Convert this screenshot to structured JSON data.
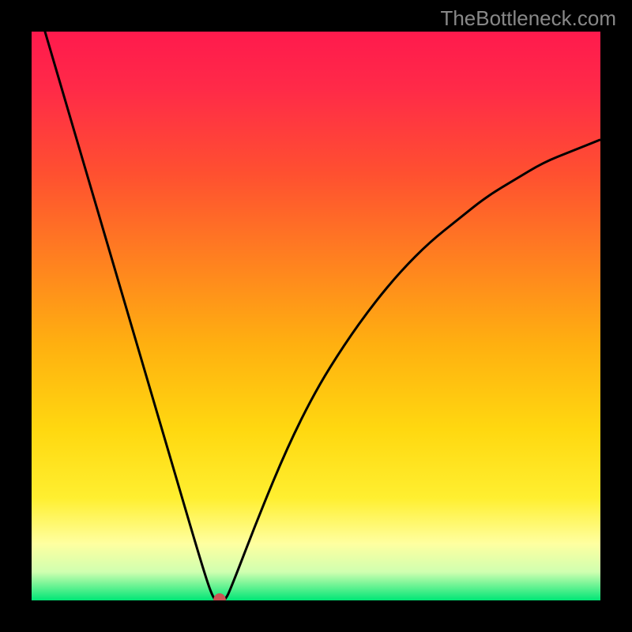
{
  "watermark": "TheBottleneck.com",
  "chart_data": {
    "type": "line",
    "title": "",
    "xlabel": "",
    "ylabel": "",
    "xlim": [
      0,
      100
    ],
    "ylim": [
      0,
      100
    ],
    "x": [
      0,
      5,
      10,
      15,
      20,
      25,
      30,
      32,
      33,
      34,
      35,
      40,
      45,
      50,
      55,
      60,
      65,
      70,
      75,
      80,
      85,
      90,
      95,
      100
    ],
    "values": [
      108,
      91,
      74,
      57,
      40,
      23,
      6,
      0,
      0,
      0,
      2,
      15,
      27,
      37,
      45,
      52,
      58,
      63,
      67,
      71,
      74,
      77,
      79,
      81
    ],
    "marker": {
      "x": 33,
      "y": 0,
      "color": "#cc5555"
    },
    "gradient_colors": {
      "top": "#ff1744",
      "upper_mid": "#ff5722",
      "mid": "#ffc107",
      "lower_mid": "#ffeb3b",
      "lower": "#ffffa0",
      "bottom": "#00e676"
    }
  }
}
